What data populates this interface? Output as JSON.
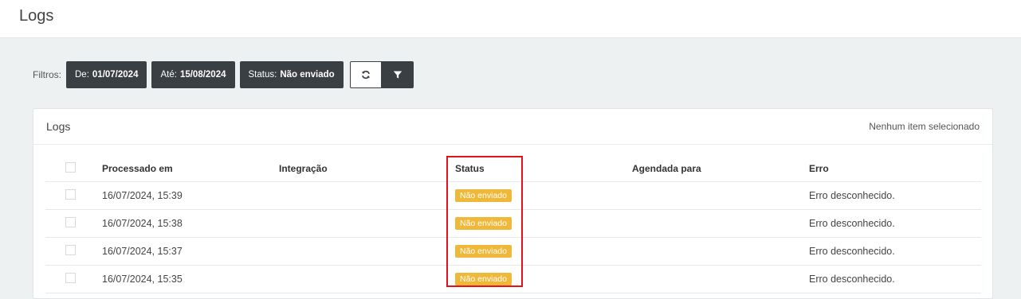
{
  "page": {
    "title": "Logs"
  },
  "filters": {
    "label": "Filtros:",
    "from": {
      "label": "De:",
      "value": "01/07/2024"
    },
    "to": {
      "label": "Até:",
      "value": "15/08/2024"
    },
    "status": {
      "label": "Status:",
      "value": "Não enviado"
    }
  },
  "panel": {
    "title": "Logs",
    "selection": "Nenhum item selecionado"
  },
  "table": {
    "headers": [
      "Processado em",
      "Integração",
      "Status",
      "Agendada para",
      "Erro"
    ],
    "rows": [
      {
        "processed": "16/07/2024, 15:39",
        "integration": "",
        "status": "Não enviado",
        "scheduled": "",
        "error": "Erro desconhecido."
      },
      {
        "processed": "16/07/2024, 15:38",
        "integration": "",
        "status": "Não enviado",
        "scheduled": "",
        "error": "Erro desconhecido."
      },
      {
        "processed": "16/07/2024, 15:37",
        "integration": "",
        "status": "Não enviado",
        "scheduled": "",
        "error": "Erro desconhecido."
      },
      {
        "processed": "16/07/2024, 15:35",
        "integration": "",
        "status": "Não enviado",
        "scheduled": "",
        "error": "Erro desconhecido."
      }
    ]
  },
  "colors": {
    "badge": "#f0b838",
    "dark": "#3a3f44",
    "highlight": "#e5121d"
  },
  "icons": {
    "refresh": "refresh-icon",
    "filter": "filter-icon"
  }
}
